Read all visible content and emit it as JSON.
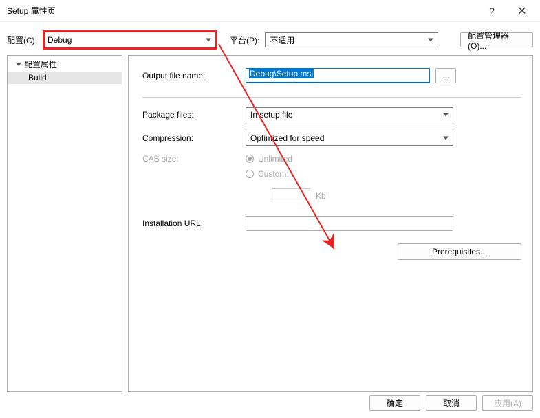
{
  "window": {
    "title": "Setup 属性页",
    "help": "?"
  },
  "topbar": {
    "config_label": "配置(C):",
    "config_value": "Debug",
    "platform_label": "平台(P):",
    "platform_value": "不适用",
    "config_manager": "配置管理器(O)..."
  },
  "tree": {
    "root": "配置属性",
    "child": "Build"
  },
  "form": {
    "output_label": "Output file name:",
    "output_value": "Debug\\Setup.msi",
    "browse": "...",
    "package_label": "Package files:",
    "package_value": "In setup file",
    "compression_label": "Compression:",
    "compression_value": "Optimized for speed",
    "cab_label": "CAB size:",
    "cab_unlimited": "Unlimited",
    "cab_custom": "Custom:",
    "cab_unit": "Kb",
    "install_url_label": "Installation URL:",
    "prerequisites": "Prerequisites..."
  },
  "footer": {
    "ok": "确定",
    "cancel": "取消",
    "apply": "应用(A)"
  }
}
